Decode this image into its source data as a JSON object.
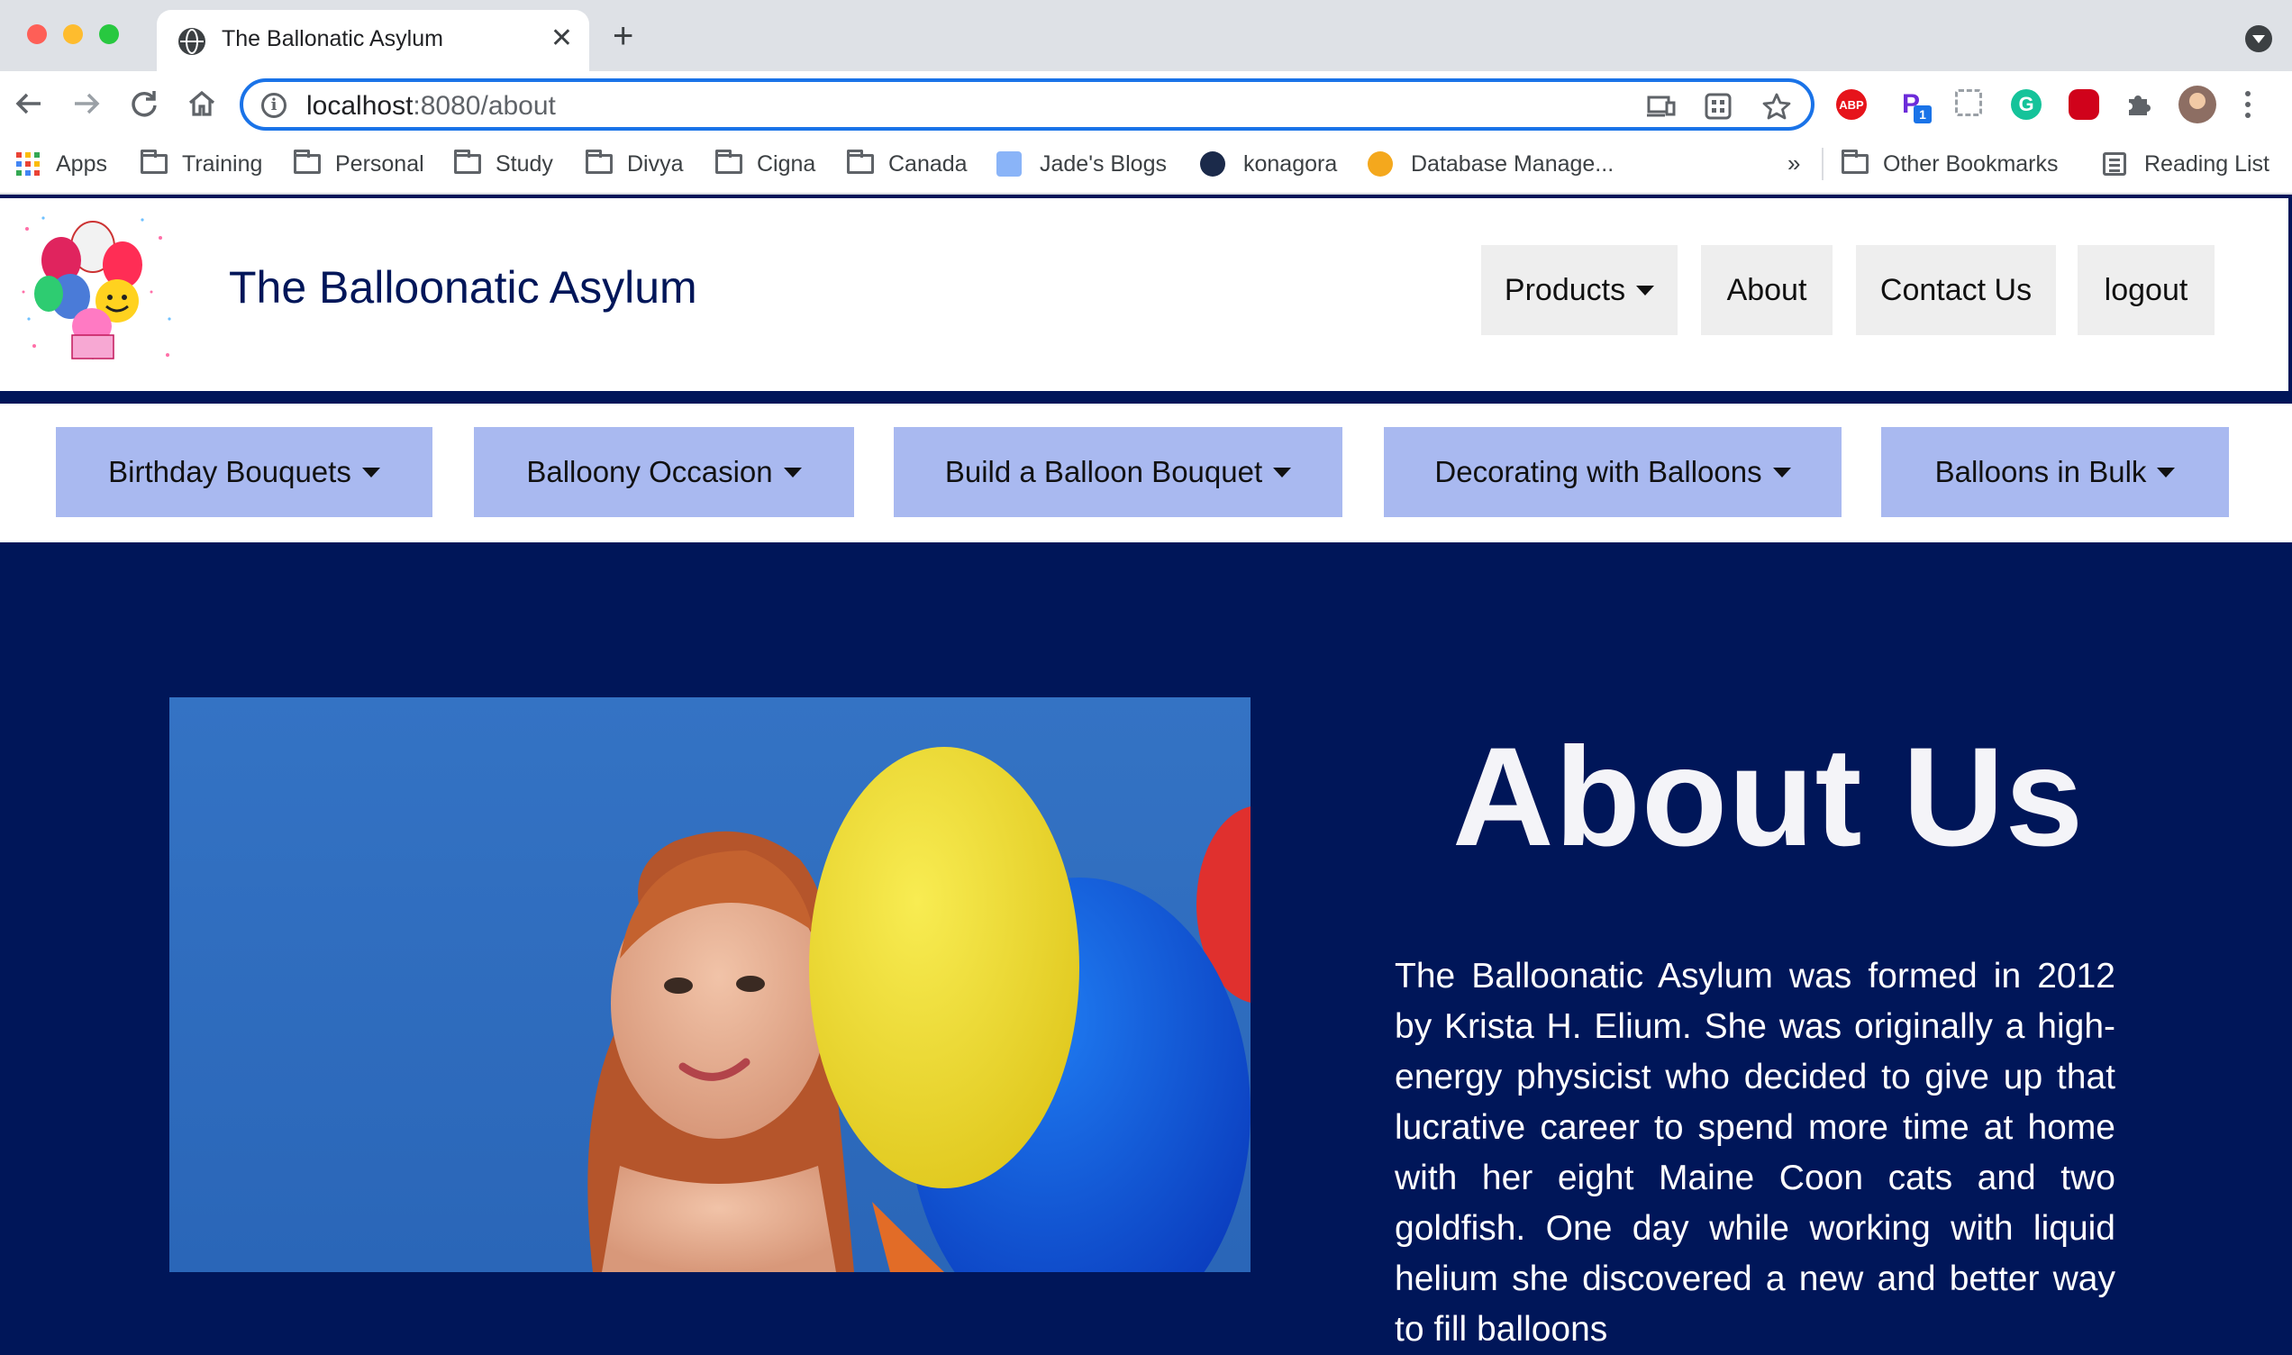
{
  "browser": {
    "tab_title": "The Ballonatic Asylum",
    "url_host": "localhost",
    "url_rest": ":8080/about",
    "extensions": {
      "abp_label": "ABP",
      "p_label": "P",
      "p_badge": "1",
      "g_label": "G"
    },
    "bookmarks": [
      {
        "label": "Apps",
        "icon": "apps-grid-icon"
      },
      {
        "label": "Training",
        "icon": "folder-icon"
      },
      {
        "label": "Personal",
        "icon": "folder-icon"
      },
      {
        "label": "Study",
        "icon": "folder-icon"
      },
      {
        "label": "Divya",
        "icon": "folder-icon"
      },
      {
        "label": "Cigna",
        "icon": "folder-icon"
      },
      {
        "label": "Canada",
        "icon": "folder-icon"
      },
      {
        "label": "Jade's Blogs",
        "icon": "blog-favicon"
      },
      {
        "label": "konagora",
        "icon": "konagora-favicon"
      },
      {
        "label": "Database Manage...",
        "icon": "database-favicon"
      }
    ],
    "bookmarks_more": "»",
    "other_bookmarks": "Other Bookmarks",
    "reading_list": "Reading List"
  },
  "site": {
    "title": "The Balloonatic Asylum",
    "nav": {
      "products": "Products",
      "about": "About",
      "contact": "Contact Us",
      "logout": "logout"
    },
    "categories": [
      "Birthday Bouquets",
      "Balloony Occasion",
      "Build a Balloon Bouquet",
      "Decorating with Balloons",
      "Balloons in Bulk"
    ],
    "about": {
      "heading": "About Us",
      "body": "The Balloonatic Asylum was formed in 2012 by Krista H. Elium. She was originally a high-energy physicist who decided to give up that lucrative career to spend more time at home with her eight Maine Coon cats and two goldfish. One day while working with liquid helium she discovered a new and better way to fill balloons"
    }
  },
  "colors": {
    "brand_navy": "#001659",
    "category_button": "#a9b9f0",
    "nav_button": "#eeeeee",
    "focus_ring": "#1a73e8"
  }
}
